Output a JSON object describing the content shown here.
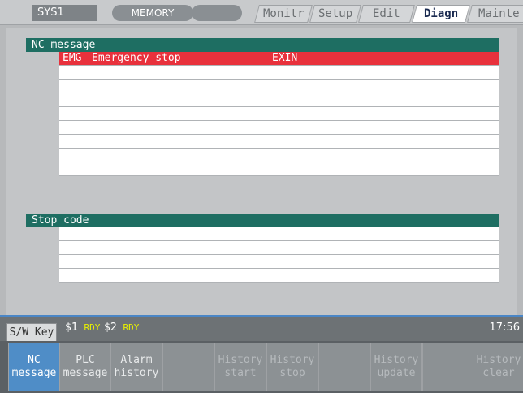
{
  "header": {
    "system": "SYS1",
    "mode": "MEMORY",
    "tabs": [
      {
        "label": "Monitr",
        "active": false
      },
      {
        "label": "Setup",
        "active": false
      },
      {
        "label": "Edit",
        "active": false
      },
      {
        "label": "Diagn",
        "active": true
      },
      {
        "label": "Mainte",
        "active": false
      }
    ]
  },
  "nc_message": {
    "title": "NC message",
    "rows": [
      {
        "code": "EMG",
        "message": "Emergency stop",
        "detail": "EXIN"
      },
      {
        "code": "",
        "message": "",
        "detail": ""
      },
      {
        "code": "",
        "message": "",
        "detail": ""
      },
      {
        "code": "",
        "message": "",
        "detail": ""
      },
      {
        "code": "",
        "message": "",
        "detail": ""
      },
      {
        "code": "",
        "message": "",
        "detail": ""
      },
      {
        "code": "",
        "message": "",
        "detail": ""
      },
      {
        "code": "",
        "message": "",
        "detail": ""
      },
      {
        "code": "",
        "message": "",
        "detail": ""
      }
    ]
  },
  "stop_code": {
    "title": "Stop code",
    "rows": [
      {
        "code": "",
        "message": "",
        "detail": ""
      },
      {
        "code": "",
        "message": "",
        "detail": ""
      },
      {
        "code": "",
        "message": "",
        "detail": ""
      },
      {
        "code": "",
        "message": "",
        "detail": ""
      }
    ]
  },
  "status": {
    "sw_key": "S/W Key",
    "ch1": "$1",
    "ch1_state": "RDY",
    "ch2": "$2",
    "ch2_state": "RDY",
    "time": "17:56"
  },
  "function_keys": [
    {
      "line1": "NC",
      "line2": "message",
      "state": "active"
    },
    {
      "line1": "PLC",
      "line2": "message",
      "state": "normal"
    },
    {
      "line1": "Alarm",
      "line2": "history",
      "state": "normal"
    },
    {
      "line1": "",
      "line2": "",
      "state": "normal"
    },
    {
      "line1": "History",
      "line2": "start",
      "state": "dim"
    },
    {
      "line1": "History",
      "line2": "stop",
      "state": "dim"
    },
    {
      "line1": "",
      "line2": "",
      "state": "normal"
    },
    {
      "line1": "History",
      "line2": "update",
      "state": "dim"
    },
    {
      "line1": "",
      "line2": "",
      "state": "normal"
    },
    {
      "line1": "History",
      "line2": "clear",
      "state": "dim"
    }
  ],
  "colors": {
    "alarm": "#e8313c",
    "section_header": "#1e6e62",
    "active_key": "#4f8dc7",
    "ready": "#e8f000"
  }
}
